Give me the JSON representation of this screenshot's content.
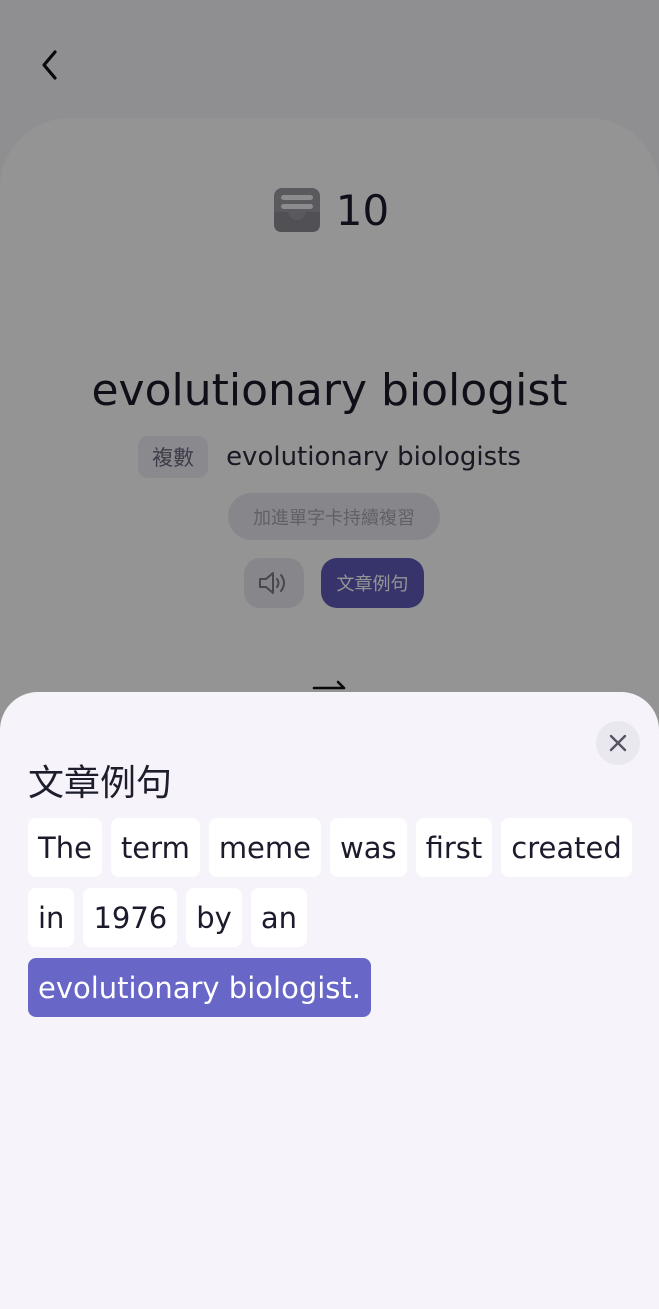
{
  "header": {
    "back_icon": "chevron-left-icon"
  },
  "card": {
    "counter_icon": "inbox-icon",
    "count": "10",
    "word": "evolutionary biologist",
    "plural_tag": "複數",
    "plural_word": "evolutionary biologists",
    "add_label": "加進單字卡持續複習",
    "sound_icon": "speaker-icon",
    "sample_label": "文章例句",
    "flip_icon": "repeat-icon"
  },
  "sheet": {
    "title": "文章例句",
    "close_icon": "close-icon",
    "tokens": [
      "The",
      "term",
      "meme",
      "was",
      "first",
      "created",
      "in",
      "1976",
      "by",
      "an",
      "evolutionary biologist."
    ],
    "highlighted_token": "evolutionary biologist."
  },
  "colors": {
    "accent": "#5d5ab8",
    "highlight": "#6866c6",
    "sheet_bg": "#f6f4fa"
  }
}
